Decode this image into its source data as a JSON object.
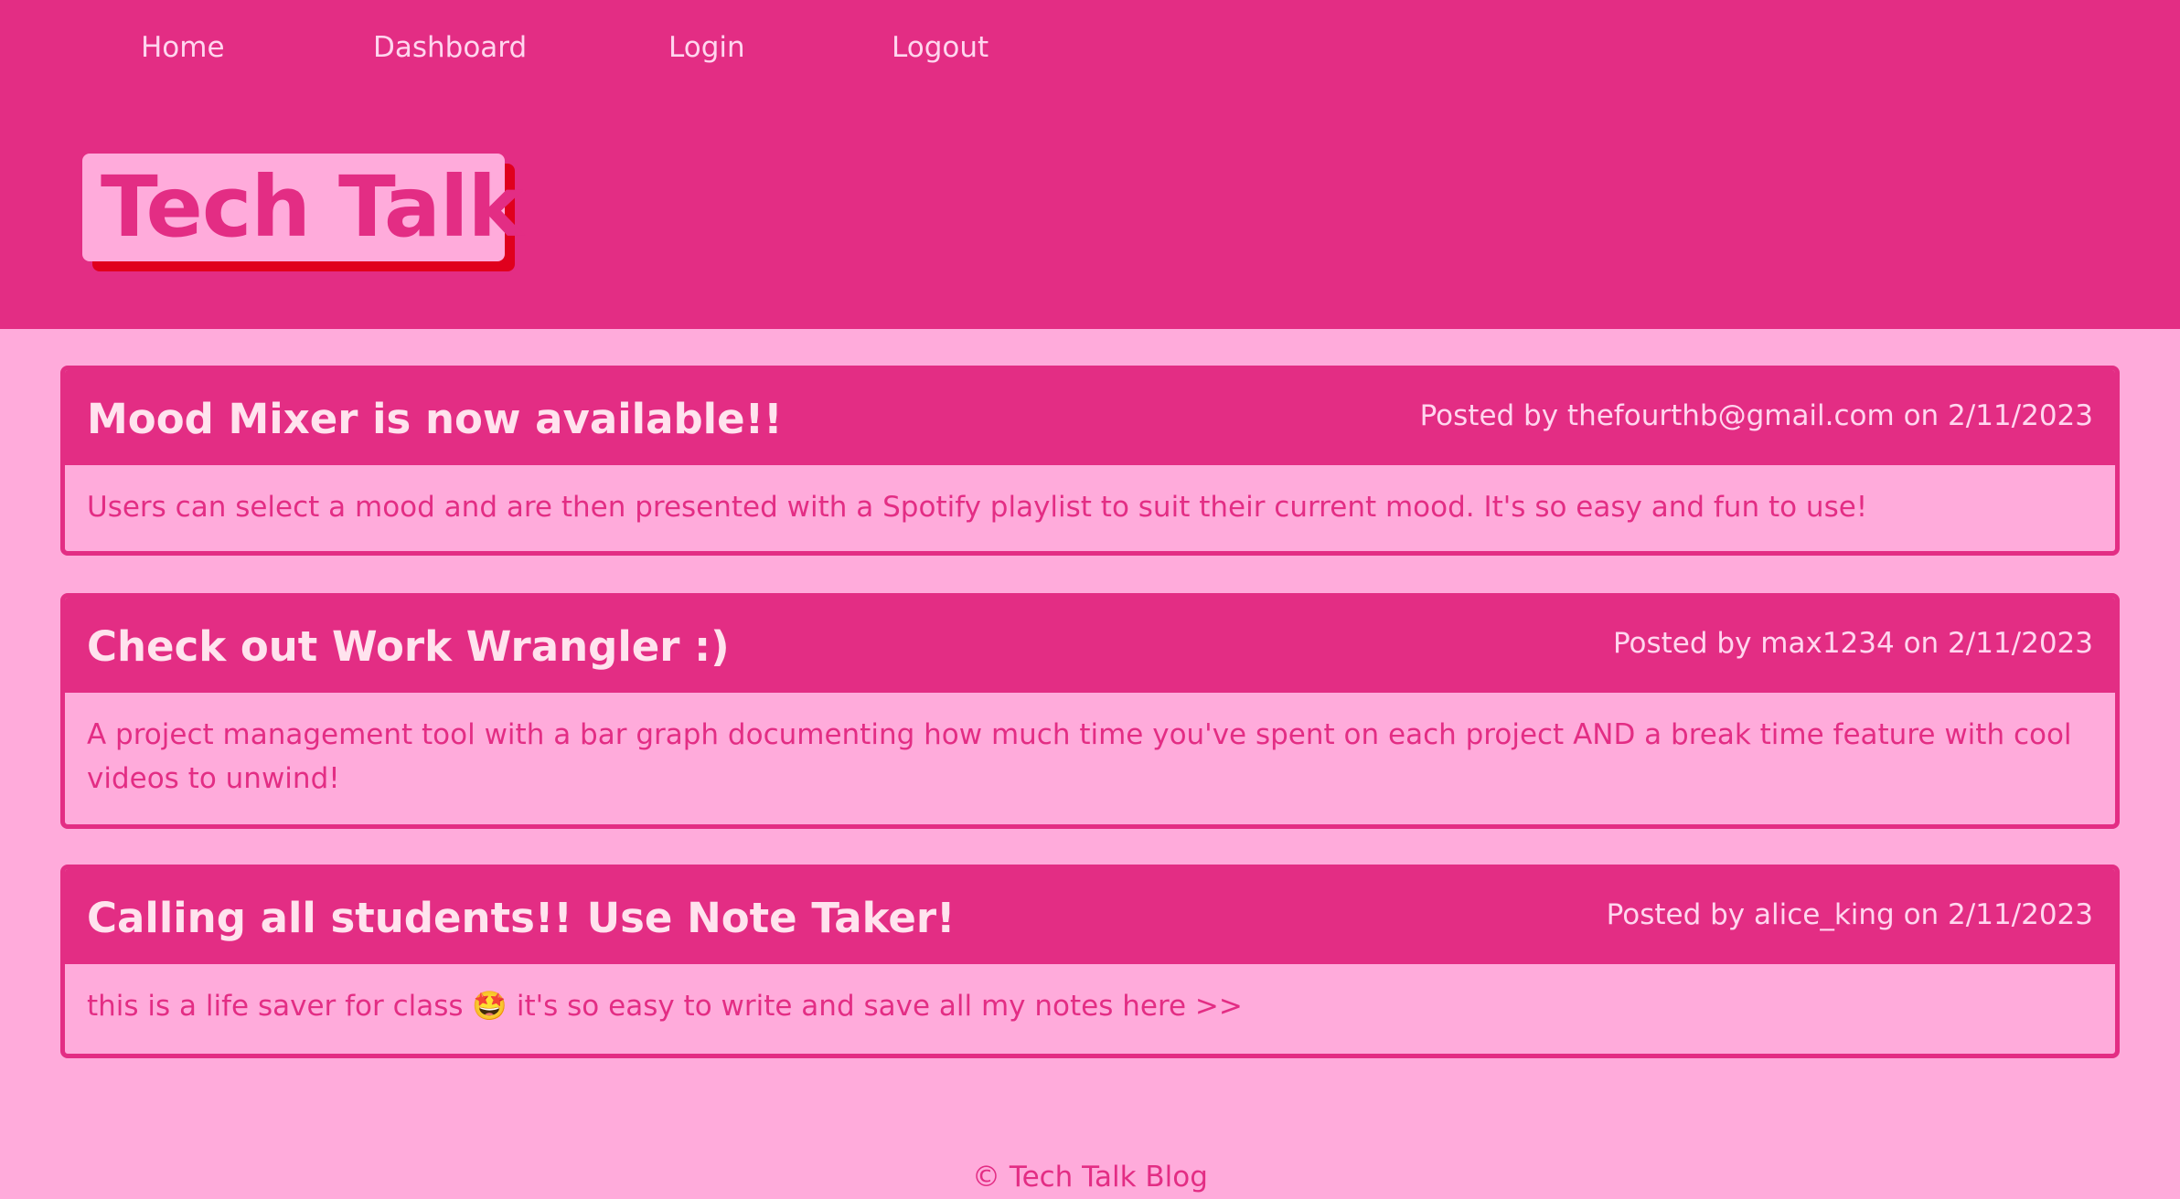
{
  "nav": {
    "links": [
      {
        "label": "Home"
      },
      {
        "label": "Dashboard"
      },
      {
        "label": "Login"
      },
      {
        "label": "Logout"
      }
    ]
  },
  "site": {
    "title": "Tech Talk",
    "footer": "© Tech Talk Blog"
  },
  "posts": [
    {
      "title": "Mood Mixer is now available!!",
      "meta": "Posted by thefourthb@gmail.com on 2/11/2023",
      "body": "Users can select a mood and are then presented with a Spotify playlist to suit their current mood. It's so easy and fun to use!"
    },
    {
      "title": "Check out Work Wrangler :)",
      "meta": "Posted by max1234 on 2/11/2023",
      "body": "A project management tool with a bar graph documenting how much time you've spent on each project AND a break time feature with cool videos to unwind!"
    },
    {
      "title": "Calling all students!! Use Note Taker!",
      "meta": "Posted by alice_king on 2/11/2023",
      "body": "this is a life saver for class 🤩 it's so easy to write and save all my notes here >>"
    }
  ],
  "colors": {
    "primary": "#e32d84",
    "background": "#ffabdb",
    "logo_shadow": "#e0001d",
    "header_text": "#ffe3ee"
  }
}
